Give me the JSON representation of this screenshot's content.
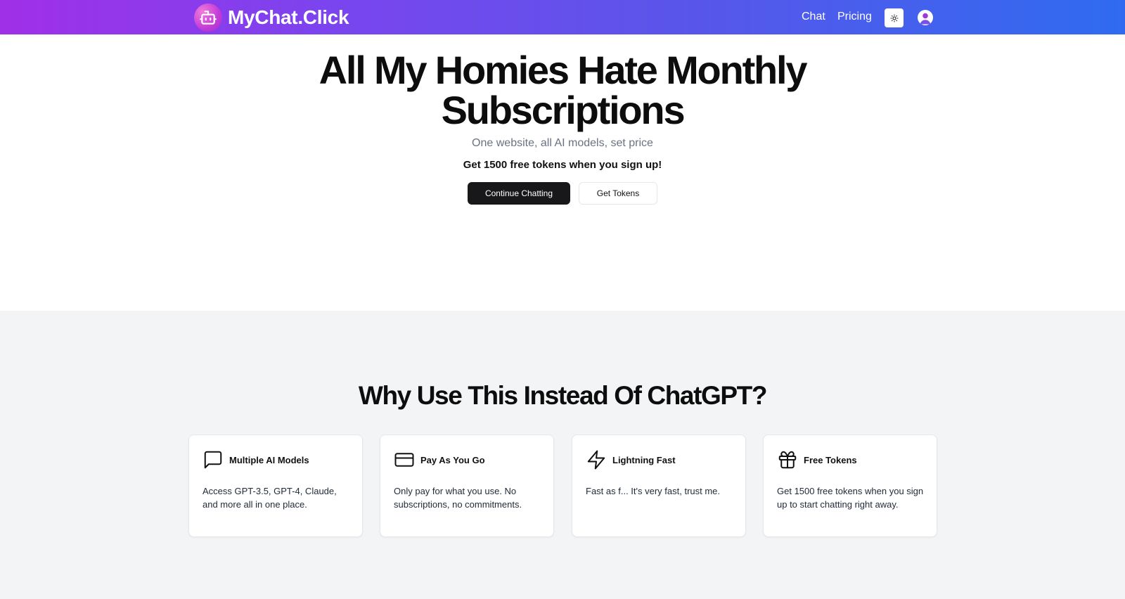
{
  "nav": {
    "brand": "MyChat.Click",
    "links": [
      "Chat",
      "Pricing"
    ],
    "icons": {
      "logo": "robot-icon",
      "theme": "sun-icon",
      "profile": "user-icon"
    }
  },
  "hero": {
    "title_line1": "All My Homies Hate Monthly",
    "title_line2": "Subscriptions",
    "subtitle": "One website, all AI models, set price",
    "promo": "Get 1500 free tokens when you sign up!",
    "primary_button": "Continue Chatting",
    "secondary_button": "Get Tokens"
  },
  "features": {
    "title": "Why Use This Instead Of ChatGPT?",
    "cards": [
      {
        "icon": "message-square-icon",
        "title": "Multiple AI Models",
        "description": "Access GPT-3.5, GPT-4, Claude, and more all in one place."
      },
      {
        "icon": "credit-card-icon",
        "title": "Pay As You Go",
        "description": "Only pay for what you use. No subscriptions, no commitments."
      },
      {
        "icon": "zap-icon",
        "title": "Lightning Fast",
        "description": "Fast as f... It's very fast, trust me."
      },
      {
        "icon": "gift-icon",
        "title": "Free Tokens",
        "description": "Get 1500 free tokens when you sign up to start chatting right away."
      }
    ]
  },
  "colors": {
    "nav_gradient_start": "#a02fe8",
    "nav_gradient_end": "#2f6bf0",
    "primary_button": "#18181b",
    "features_background": "#f3f4f6"
  }
}
